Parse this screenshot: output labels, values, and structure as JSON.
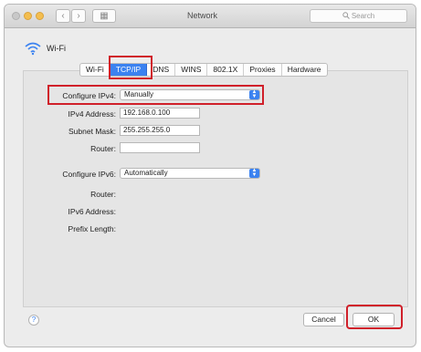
{
  "window": {
    "title": "Network"
  },
  "toolbar": {
    "back_glyph": "‹",
    "forward_glyph": "›",
    "grid_glyph": "▦"
  },
  "search": {
    "placeholder": "Search"
  },
  "interface": {
    "name": "Wi-Fi"
  },
  "tabs": [
    {
      "label": "Wi-Fi",
      "selected": false
    },
    {
      "label": "TCP/IP",
      "selected": true
    },
    {
      "label": "DNS",
      "selected": false
    },
    {
      "label": "WINS",
      "selected": false
    },
    {
      "label": "802.1X",
      "selected": false
    },
    {
      "label": "Proxies",
      "selected": false
    },
    {
      "label": "Hardware",
      "selected": false
    }
  ],
  "ipv4": {
    "configure_label": "Configure IPv4:",
    "configure_value": "Manually",
    "address_label": "IPv4 Address:",
    "address_value": "192.168.0.100",
    "subnet_label": "Subnet Mask:",
    "subnet_value": "255.255.255.0",
    "router_label": "Router:",
    "router_value": ""
  },
  "ipv6": {
    "configure_label": "Configure IPv6:",
    "configure_value": "Automatically",
    "router_label": "Router:",
    "address_label": "IPv6 Address:",
    "prefix_label": "Prefix Length:"
  },
  "footer": {
    "help_glyph": "?",
    "cancel_label": "Cancel",
    "ok_label": "OK"
  },
  "colors": {
    "accent": "#3b82f0",
    "highlight_box": "#d0202a"
  }
}
